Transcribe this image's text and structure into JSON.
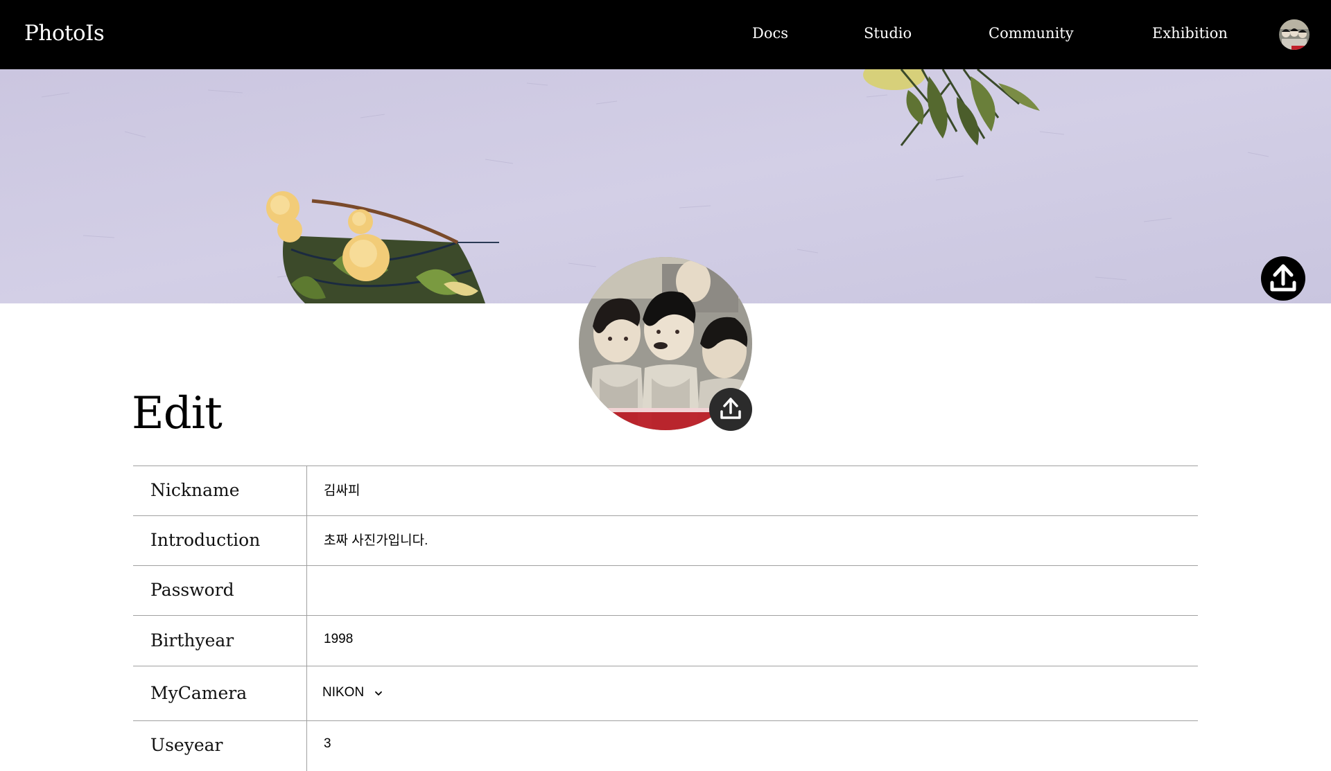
{
  "navbar": {
    "logo": "PhotoIs",
    "links": [
      "Docs",
      "Studio",
      "Community",
      "Exhibition"
    ],
    "avatar_icon": "user-avatar"
  },
  "banner": {
    "upload_icon": "upload-icon"
  },
  "profile": {
    "upload_icon": "upload-icon"
  },
  "page": {
    "title": "Edit"
  },
  "form": {
    "nickname": {
      "label": "Nickname",
      "value": "김싸피"
    },
    "introduction": {
      "label": "Introduction",
      "value": "초짜 사진가입니다."
    },
    "password": {
      "label": "Password",
      "value": ""
    },
    "birthyear": {
      "label": "Birthyear",
      "value": "1998"
    },
    "mycamera": {
      "label": "MyCamera",
      "value": "NIKON",
      "icon": "chevron-down-icon"
    },
    "useyear": {
      "label": "Useyear",
      "value": "3"
    }
  },
  "colors": {
    "navbar_bg": "#000000",
    "banner_bg": "#cdc9e2",
    "border": "#a0a0a0",
    "upload_button": "#000000"
  }
}
